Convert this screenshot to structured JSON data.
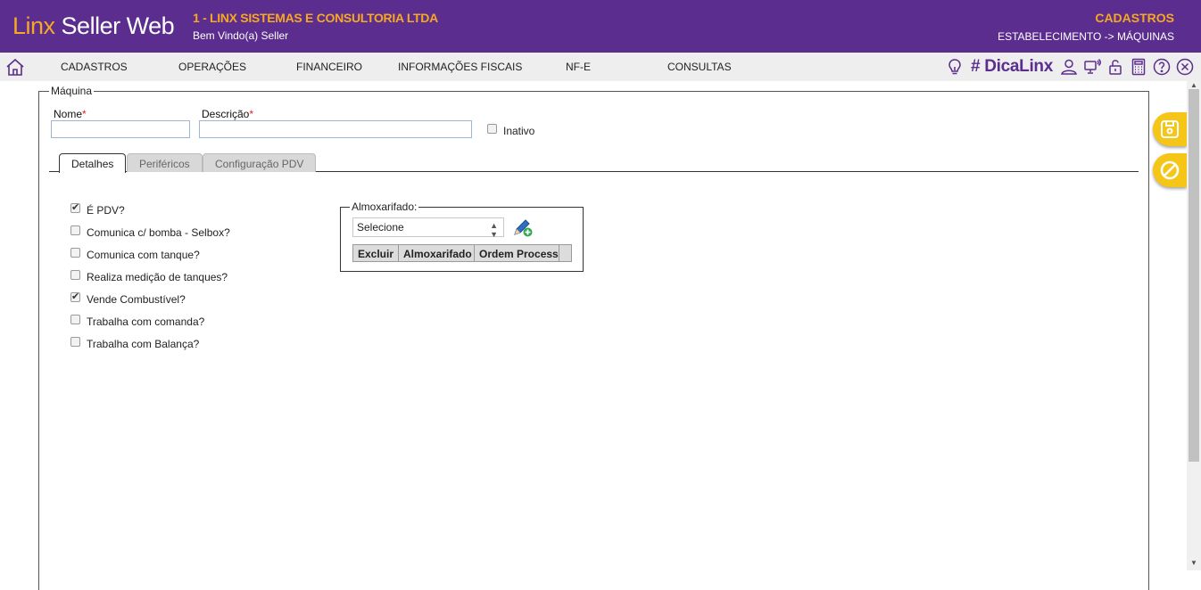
{
  "header": {
    "brand_part1": "Linx",
    "brand_part2": "Seller Web",
    "company": "1 - LINX SISTEMAS E CONSULTORIA LTDA",
    "welcome": "Bem Vindo(a) Seller",
    "section": "CADASTROS",
    "breadcrumb": "ESTABELECIMENTO -> MÁQUINAS"
  },
  "nav": {
    "items": [
      "CADASTROS",
      "OPERAÇÕES",
      "FINANCEIRO",
      "INFORMAÇÕES FISCAIS",
      "NF-E",
      "CONSULTAS"
    ],
    "dica": "# DicaLinx"
  },
  "form": {
    "legend": "Máquina",
    "nome_label": "Nome",
    "descricao_label": "Descrição",
    "required_mark": "*",
    "nome_value": "",
    "descricao_value": "",
    "inativo_label": "Inativo",
    "inativo_checked": false
  },
  "tabs": [
    {
      "label": "Detalhes",
      "active": true
    },
    {
      "label": "Periféricos",
      "active": false
    },
    {
      "label": "Configuração PDV",
      "active": false
    }
  ],
  "options": [
    {
      "label": "É PDV?",
      "checked": true
    },
    {
      "label": "Comunica c/ bomba - Selbox?",
      "checked": false
    },
    {
      "label": "Comunica com tanque?",
      "checked": false
    },
    {
      "label": "Realiza medição de tanques?",
      "checked": false
    },
    {
      "label": "Vende Combustível?",
      "checked": true
    },
    {
      "label": "Trabalha com comanda?",
      "checked": false
    },
    {
      "label": "Trabalha com Balança?",
      "checked": false
    }
  ],
  "almoxarifado": {
    "legend": "Almoxarifado:",
    "select_value": "Selecione",
    "buttons": [
      "Excluir",
      "Almoxarifado",
      "Ordem Process.",
      ""
    ]
  },
  "colors": {
    "header_bg": "#5b2d8e",
    "accent": "#f7a823",
    "fab": "#f5c518"
  }
}
